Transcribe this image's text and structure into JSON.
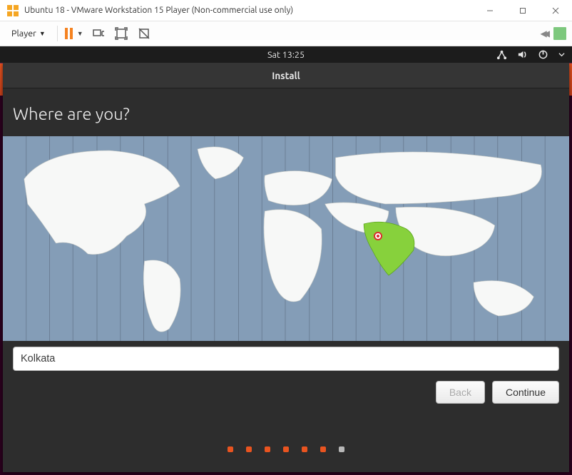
{
  "window": {
    "title": "Ubuntu 18 - VMware Workstation 15 Player (Non-commercial use only)"
  },
  "player_toolbar": {
    "menu_label": "Player"
  },
  "gnome": {
    "clock": "Sat 13:25"
  },
  "ubiquity": {
    "window_title": "Install",
    "heading": "Where are you?",
    "timezone_value": "Kolkata",
    "buttons": {
      "back": "Back",
      "continue": "Continue"
    },
    "progress": {
      "done": 6,
      "total": 7
    }
  },
  "map": {
    "highlight_region": "India",
    "pin": {
      "x_pct": 66.3,
      "y_pct": 48.7
    }
  }
}
